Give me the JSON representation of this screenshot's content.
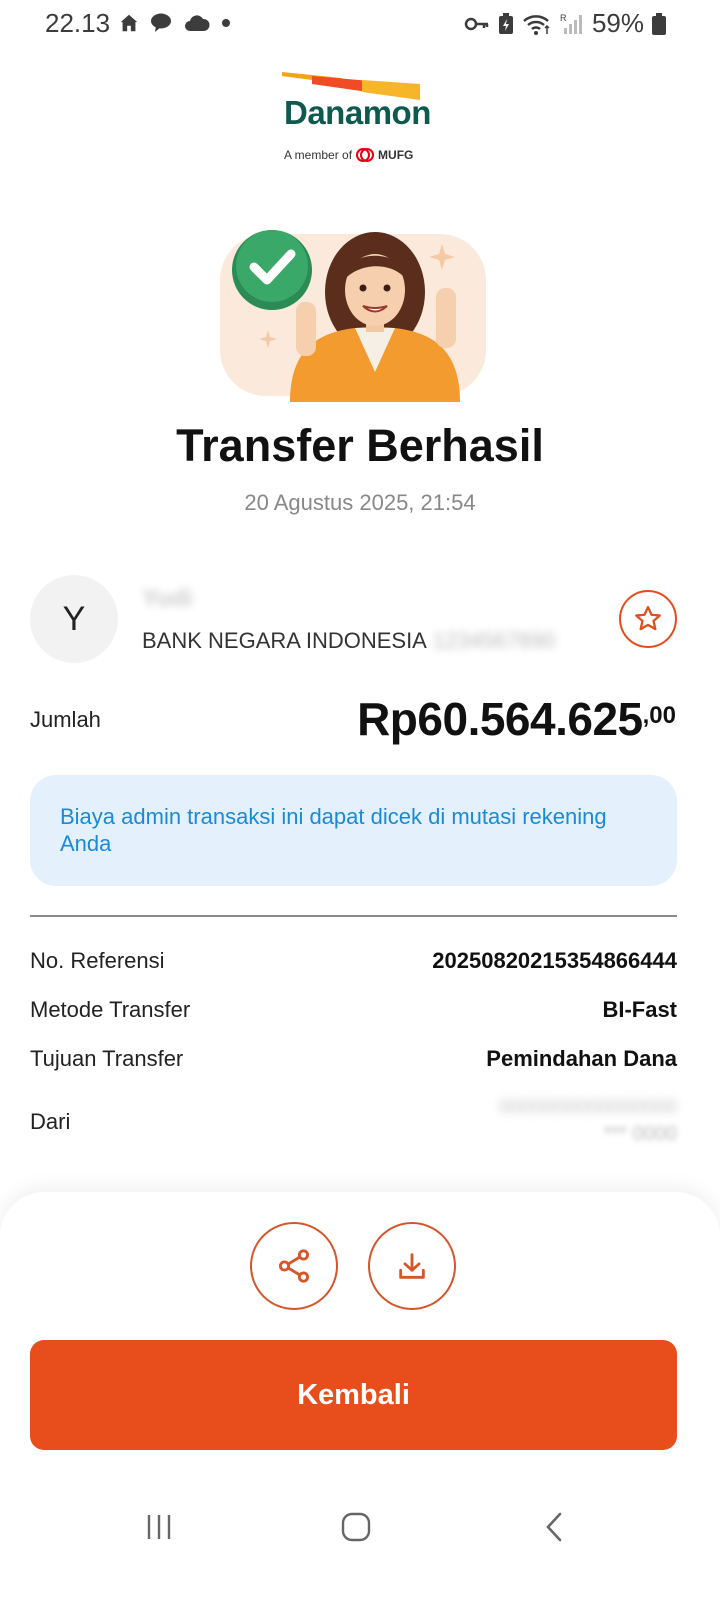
{
  "status_bar": {
    "time": "22.13",
    "battery_text": "59%",
    "left_icons": [
      "home-icon",
      "chat-icon",
      "cloud-icon",
      "dot-icon"
    ],
    "right_icons": [
      "key-icon",
      "battery-saver-icon",
      "wifi-icon",
      "signal-icon",
      "battery-icon"
    ]
  },
  "logo": {
    "wordmark": "Danamon",
    "member_text": "A member of",
    "mufg": "MUFG"
  },
  "result": {
    "title": "Transfer Berhasil",
    "datetime": "20 Agustus 2025, 21:54"
  },
  "recipient": {
    "initial": "Y",
    "name": "Yudi",
    "bank": "BANK NEGARA INDONESIA",
    "account_number": "1234567890"
  },
  "amount": {
    "label": "Jumlah",
    "value": "Rp60.564.625",
    "decimals": ",00"
  },
  "info": {
    "text": "Biaya admin transaksi ini dapat dicek di mutasi rekening Anda"
  },
  "details": [
    {
      "label": "No. Referensi",
      "value": "20250820215354866444"
    },
    {
      "label": "Metode Transfer",
      "value": "BI-Fast"
    },
    {
      "label": "Tujuan Transfer",
      "value": "Pemindahan Dana"
    },
    {
      "label": "Dari",
      "value": "0000000000000000",
      "sub_value": "*** 0000"
    }
  ],
  "actions": {
    "share_icon": "share-icon",
    "download_icon": "download-icon",
    "back_label": "Kembali"
  },
  "colors": {
    "brand_orange": "#e84e1b",
    "brand_green": "#0e5a4e",
    "info_bg": "#e4f1fc",
    "info_text": "#1a8ad6"
  }
}
